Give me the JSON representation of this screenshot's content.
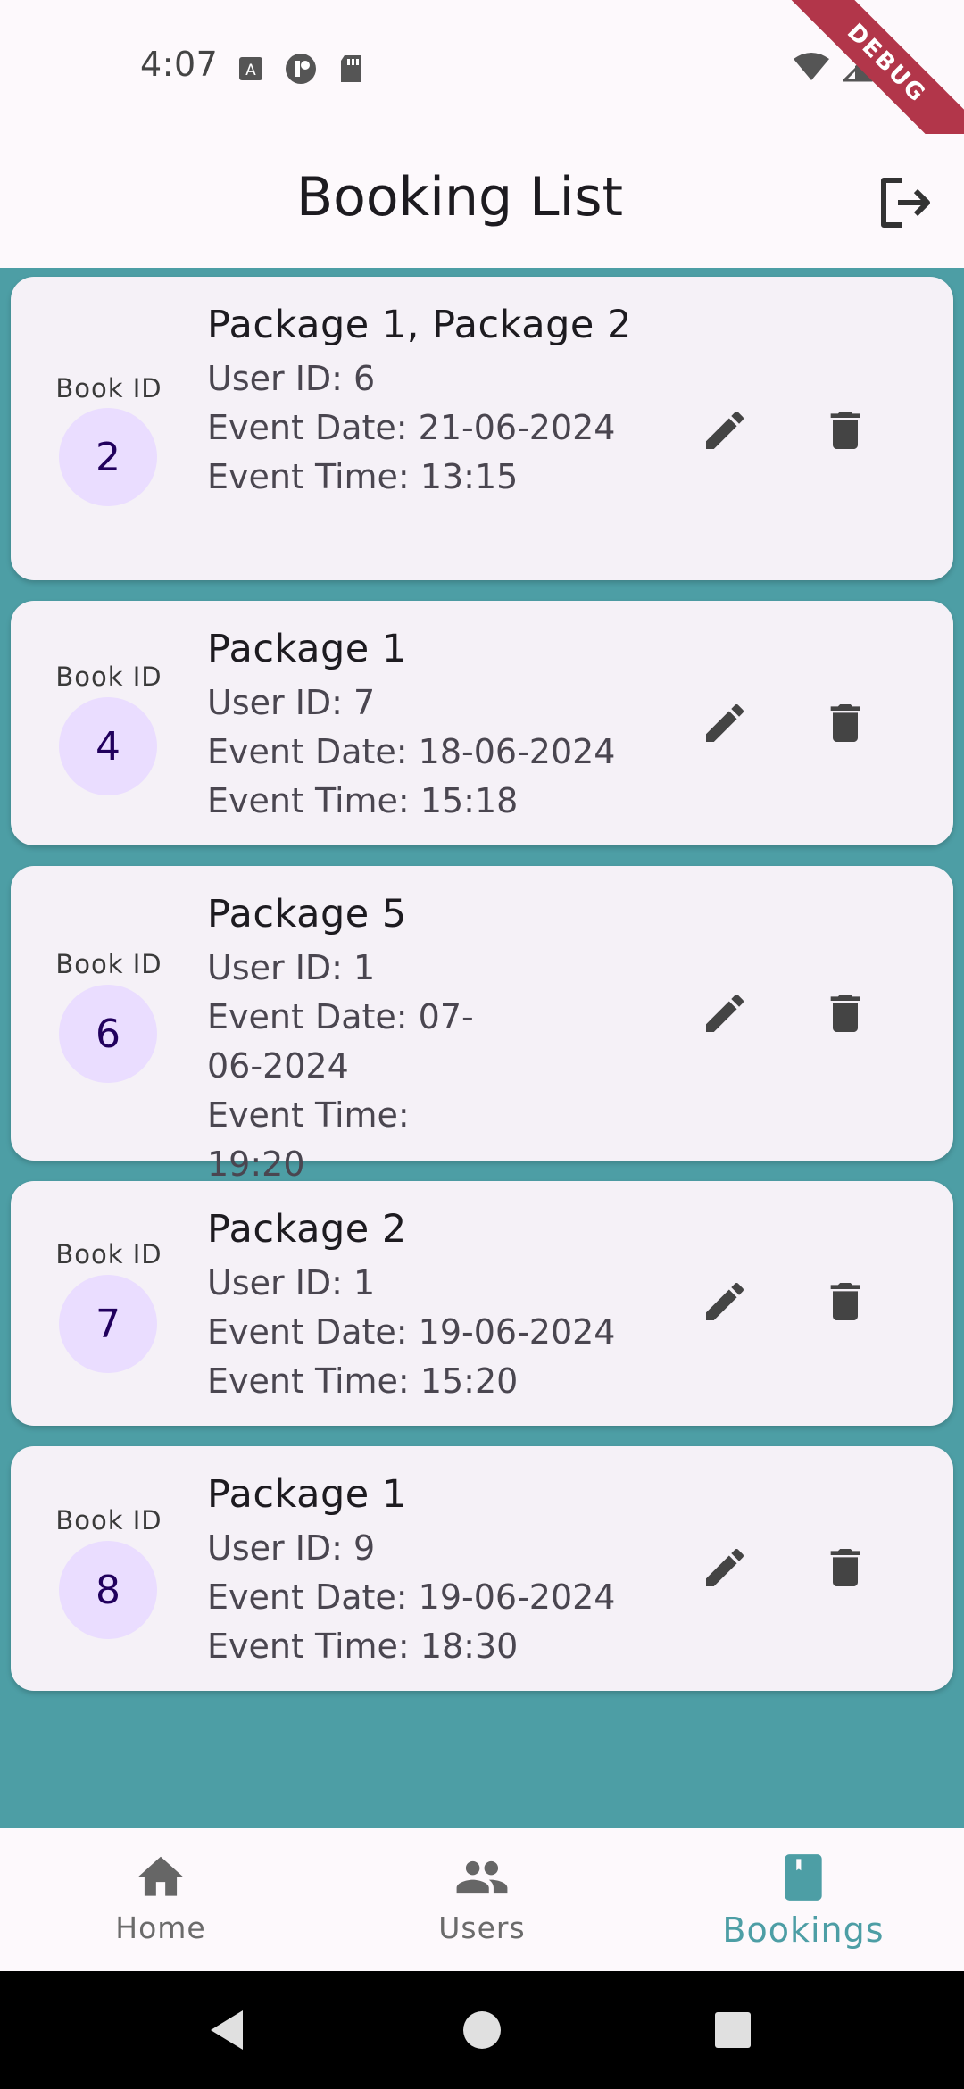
{
  "status_bar": {
    "time": "4:07",
    "left_icons": [
      "text-a-icon",
      "circle-app-icon",
      "sd-card-icon"
    ],
    "right_icons": [
      "wifi-icon",
      "cell-signal-icon",
      "battery-icon"
    ],
    "debug_label": "DEBUG"
  },
  "app_bar": {
    "title": "Booking List",
    "logout_icon": "logout-icon"
  },
  "bookings": [
    {
      "book_id_label": "Book ID",
      "book_id": "2",
      "packages": "Package 1, Package 2",
      "user_id": "User ID: 6",
      "event_date": "Event Date: 21-06-2024",
      "event_time": "Event Time: 13:15"
    },
    {
      "book_id_label": "Book ID",
      "book_id": "4",
      "packages": "Package 1",
      "user_id": "User ID: 7",
      "event_date": "Event Date: 18-06-2024",
      "event_time": "Event Time: 15:18"
    },
    {
      "book_id_label": "Book ID",
      "book_id": "6",
      "packages": "Package 5",
      "user_id": "User ID: 1",
      "event_date": "Event Date: 07-06-2024",
      "event_time": "Event Time: 19:20"
    },
    {
      "book_id_label": "Book ID",
      "book_id": "7",
      "packages": "Package 2",
      "user_id": "User ID: 1",
      "event_date": "Event Date: 19-06-2024",
      "event_time": "Event Time: 15:20"
    },
    {
      "book_id_label": "Book ID",
      "book_id": "8",
      "packages": "Package 1",
      "user_id": "User ID: 9",
      "event_date": "Event Date: 19-06-2024",
      "event_time": "Event Time: 18:30"
    }
  ],
  "bottom_nav": {
    "items": [
      {
        "label": "Home",
        "icon": "home-icon",
        "active": false
      },
      {
        "label": "Users",
        "icon": "people-icon",
        "active": false
      },
      {
        "label": "Bookings",
        "icon": "bookmark-book-icon",
        "active": true
      }
    ]
  },
  "system_nav": {
    "icons": [
      "back-icon",
      "home-circle-icon",
      "recents-icon"
    ]
  },
  "colors": {
    "accent": "#4d9ea5",
    "circle_bg": "#eaddff",
    "card_bg": "#f5f1f7",
    "debug_ribbon": "#b2364a"
  }
}
